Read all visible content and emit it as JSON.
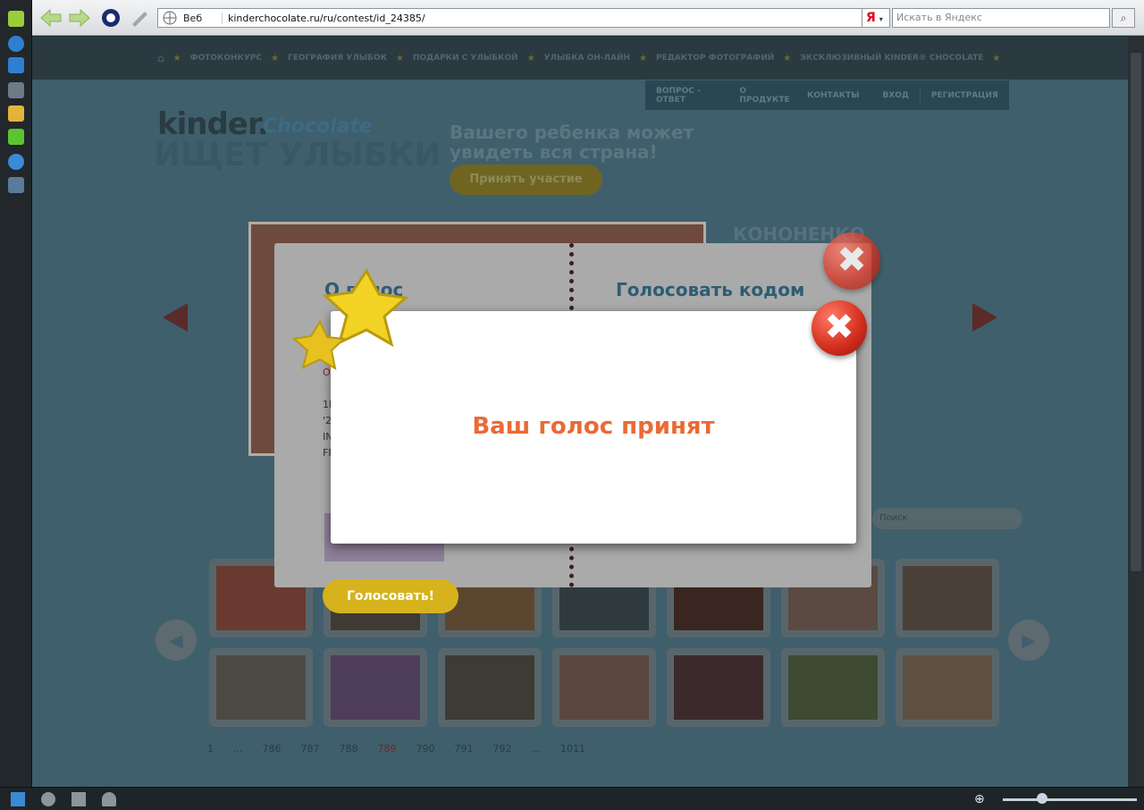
{
  "browser": {
    "address_type": "Веб",
    "url": "kinderchocolate.ru/ru/contest/id_24385/",
    "search_engine_logo": "Я",
    "search_placeholder": "Искать в Яндекс",
    "search_go_icon": "search-icon"
  },
  "site": {
    "nav": [
      "ФОТОКОНКУРС",
      "ГЕОГРАФИЯ УЛЫБОК",
      "ПОДАРКИ С УЛЫБКОЙ",
      "УЛЫБКА ОН-ЛАЙН",
      "РЕДАКТОР ФОТОГРАФИЙ",
      "ЭКСКЛЮЗИВНЫЙ KINDER® CHOCOLATE"
    ],
    "sub_nav": [
      "ВОПРОС - ОТВЕТ",
      "О ПРОДУКТЕ",
      "КОНТАКТЫ",
      "ВХОД",
      "РЕГИСТРАЦИЯ"
    ],
    "logo_kinder": "kinder.",
    "logo_chocolate": "Chocolate",
    "logo_smiles": "ИЩЕТ УЛЫБКИ",
    "promo": "Вашего ребенка может увидеть вся страна!",
    "participate_button": "Принять участие",
    "name_partial": "КОНОНЕНКО",
    "search_placeholder": "Поиск",
    "pagination": [
      "1",
      "...",
      "786",
      "787",
      "788",
      "789",
      "790",
      "791",
      "792",
      "...",
      "1011"
    ],
    "pagination_active": "789"
  },
  "vote_dialog": {
    "left_title": "О      голос",
    "right_title": "Голосовать кодом",
    "left_lines": [
      "О",
      "1L",
      "'2",
      "IN",
      "FF"
    ],
    "vote_button": "Голосовать!"
  },
  "result_modal": {
    "message": "Ваш голос принят"
  },
  "colors": {
    "accent_orange": "#ea6a34",
    "close_red": "#d22b1b",
    "star_yellow": "#f2d224"
  }
}
